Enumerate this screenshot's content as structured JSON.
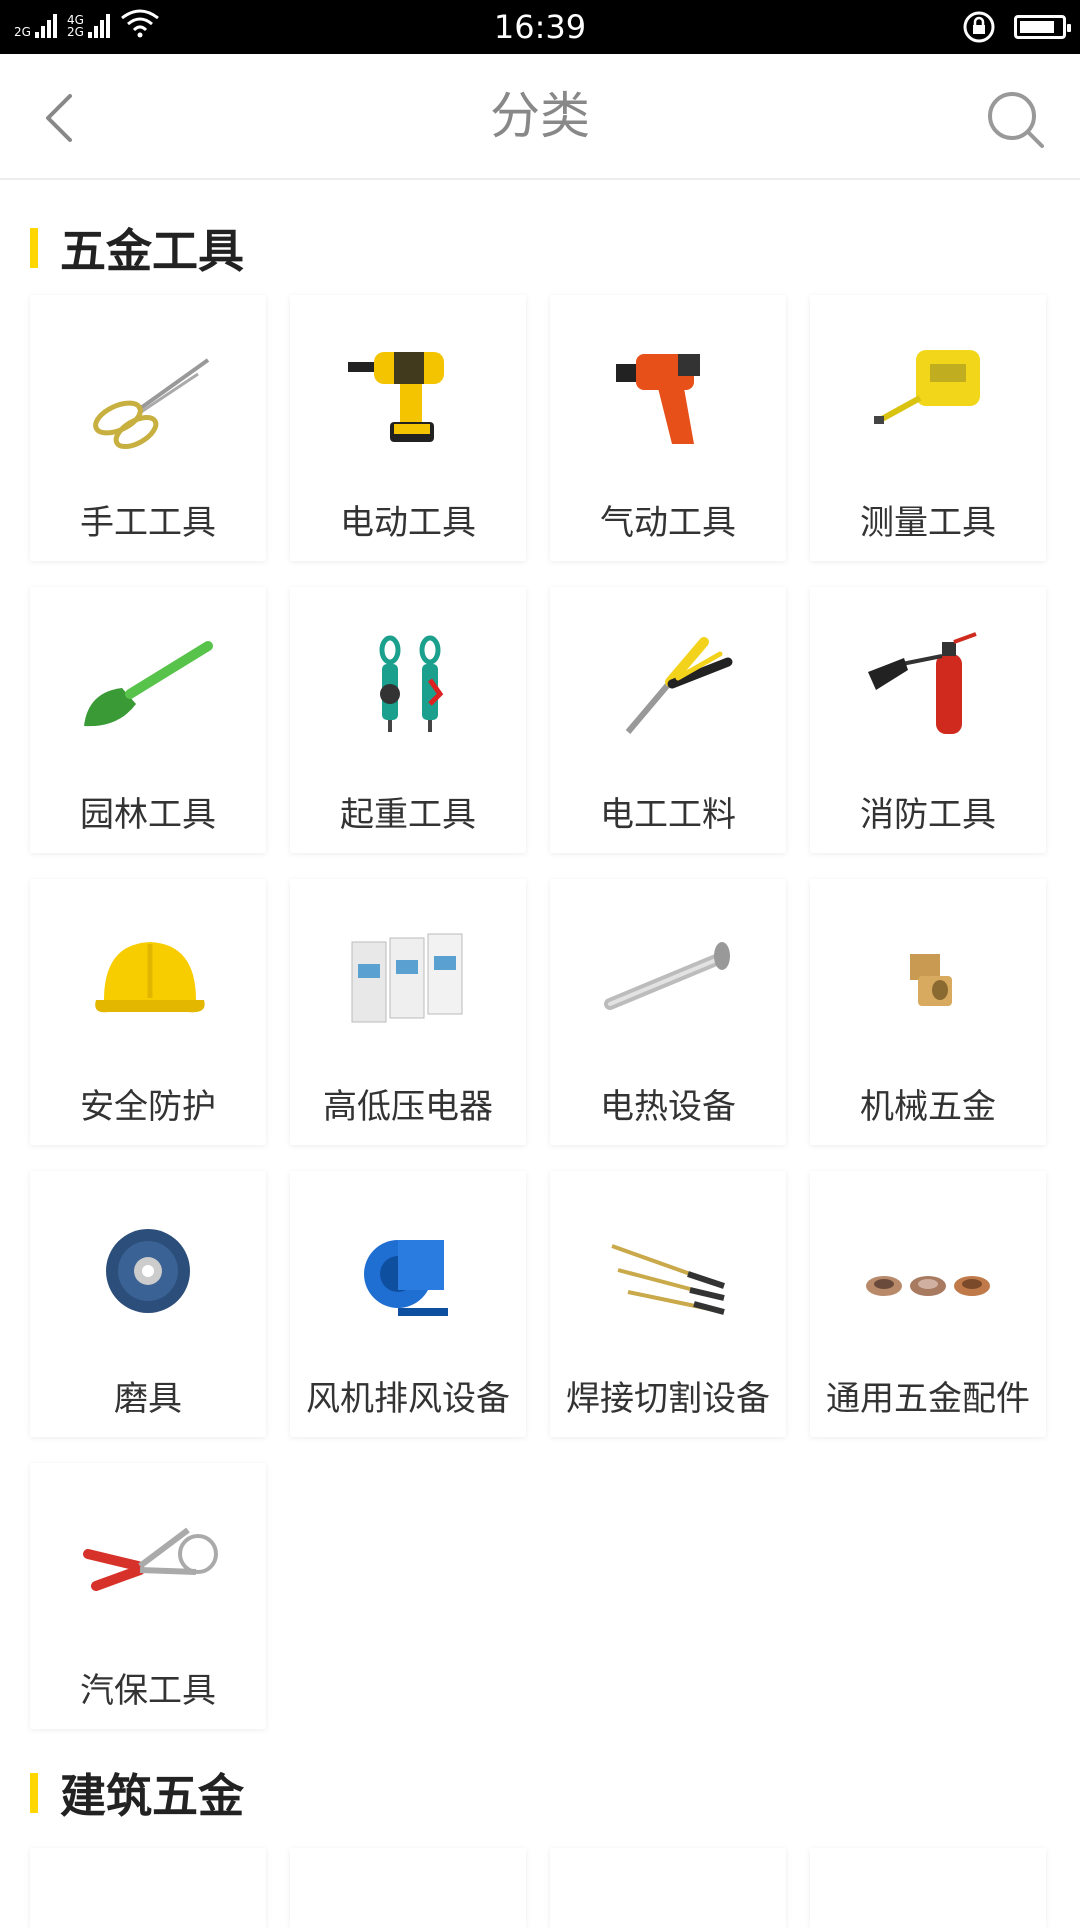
{
  "status_bar": {
    "network_1": "2G",
    "network_2_top": "4G",
    "network_2_bottom": "2G",
    "time": "16:39",
    "battery_level": 0.85
  },
  "header": {
    "title": "分类",
    "back_icon": "chevron-left-icon",
    "search_icon": "search-icon"
  },
  "sections": [
    {
      "title": "五金工具",
      "items": [
        {
          "label": "手工工具",
          "icon": "scissors-icon"
        },
        {
          "label": "电动工具",
          "icon": "drill-icon"
        },
        {
          "label": "气动工具",
          "icon": "air-gun-icon"
        },
        {
          "label": "测量工具",
          "icon": "tape-measure-icon"
        },
        {
          "label": "园林工具",
          "icon": "trowel-icon"
        },
        {
          "label": "起重工具",
          "icon": "pulley-hook-icon"
        },
        {
          "label": "电工工料",
          "icon": "pliers-icon"
        },
        {
          "label": "消防工具",
          "icon": "fire-extinguisher-icon"
        },
        {
          "label": "安全防护",
          "icon": "helmet-icon"
        },
        {
          "label": "高低压电器",
          "icon": "circuit-breaker-icon"
        },
        {
          "label": "电热设备",
          "icon": "heating-tube-icon"
        },
        {
          "label": "机械五金",
          "icon": "brass-fitting-icon"
        },
        {
          "label": "磨具",
          "icon": "grinding-disc-icon"
        },
        {
          "label": "风机排风设备",
          "icon": "blower-fan-icon"
        },
        {
          "label": "焊接切割设备",
          "icon": "welding-torch-icon"
        },
        {
          "label": "通用五金配件",
          "icon": "bushing-icon"
        },
        {
          "label": "汽保工具",
          "icon": "ring-pliers-icon"
        }
      ]
    },
    {
      "title": "建筑五金"
    }
  ],
  "colors": {
    "accent": "#ffd600",
    "status_bar_bg": "#000000",
    "title_text": "#888888",
    "label_text": "#333333"
  }
}
